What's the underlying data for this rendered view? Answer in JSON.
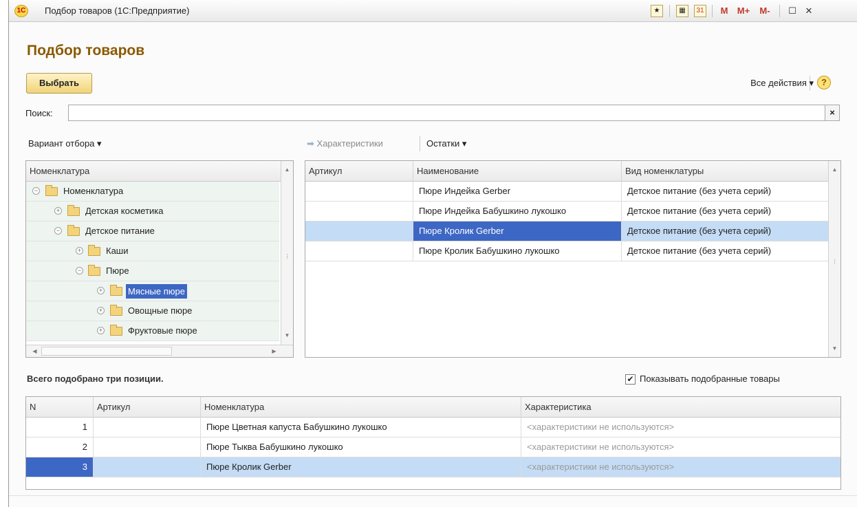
{
  "window": {
    "logo": "1С",
    "title": "Подбор товаров  (1С:Предприятие)",
    "toolbar": [
      "M",
      "M+",
      "M-"
    ]
  },
  "form": {
    "title": "Подбор товаров",
    "select_button": "Выбрать",
    "all_actions": "Все действия ▾",
    "help": "?"
  },
  "search": {
    "label": "Поиск:",
    "value": "",
    "clear": "×"
  },
  "filters": {
    "variant": "Вариант отбора ▾",
    "characteristics": "Характеристики",
    "remains": "Остатки ▾"
  },
  "tree": {
    "header": "Номенклатура",
    "items": [
      {
        "label": "Номенклатура",
        "level": 0,
        "expanded": true
      },
      {
        "label": "Детская косметика",
        "level": 1,
        "expanded": false
      },
      {
        "label": "Детское питание",
        "level": 1,
        "expanded": true
      },
      {
        "label": "Каши",
        "level": 2,
        "expanded": false
      },
      {
        "label": "Пюре",
        "level": 2,
        "expanded": true
      },
      {
        "label": "Мясные пюре",
        "level": 3,
        "expanded": false,
        "selected": true
      },
      {
        "label": "Овощные пюре",
        "level": 3,
        "expanded": false
      },
      {
        "label": "Фруктовые пюре",
        "level": 3,
        "expanded": false
      }
    ]
  },
  "goods": {
    "columns": [
      "Артикул",
      "Наименование",
      "Вид номенклатуры"
    ],
    "rows": [
      {
        "article": "",
        "name": "Пюре Индейка Gerber",
        "kind": "Детское питание (без учета серий)"
      },
      {
        "article": "",
        "name": "Пюре Индейка Бабушкино лукошко",
        "kind": "Детское питание (без учета серий)"
      },
      {
        "article": "",
        "name": "Пюре Кролик Gerber",
        "kind": "Детское питание (без учета серий)",
        "selected": true
      },
      {
        "article": "",
        "name": "Пюре Кролик Бабушкино лукошко",
        "kind": "Детское питание (без учета серий)"
      }
    ]
  },
  "summary": {
    "text": "Всего подобрано три позиции.",
    "show_selected_label": "Показывать подобранные товары",
    "show_selected_checked": true
  },
  "picked": {
    "columns": [
      "N",
      "Артикул",
      "Номенклатура",
      "Характеристика"
    ],
    "rows": [
      {
        "n": "1",
        "article": "",
        "name": "Пюре Цветная капуста Бабушкино лукошко",
        "characteristic": "<характеристики не используются>"
      },
      {
        "n": "2",
        "article": "",
        "name": "Пюре Тыква Бабушкино лукошко",
        "characteristic": "<характеристики не используются>"
      },
      {
        "n": "3",
        "article": "",
        "name": "Пюре Кролик Gerber",
        "characteristic": "<характеристики не используются>",
        "selected": true
      }
    ]
  },
  "colors": {
    "title_accent": "#8a5a00",
    "selection": "#3d67c4",
    "row_highlight": "#c4dcf5"
  }
}
